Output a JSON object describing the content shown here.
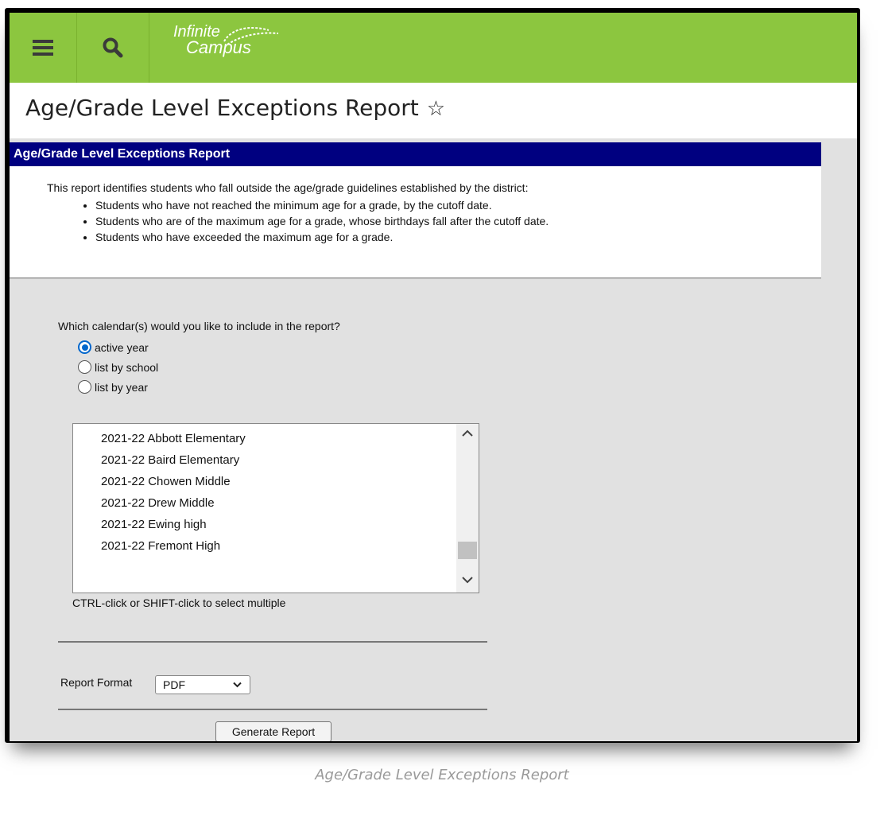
{
  "app": {
    "logo_line1": "Infinite",
    "logo_line2": "Campus",
    "brand_color": "#8cc63f",
    "icons": [
      "menu-icon",
      "search-icon",
      "star-icon"
    ]
  },
  "page": {
    "title": "Age/Grade Level Exceptions Report",
    "star": "☆"
  },
  "report": {
    "header": "Age/Grade Level Exceptions Report",
    "header_color": "#000080",
    "intro": "This report identifies students who fall outside the age/grade guidelines established by the district:",
    "bullets": [
      "Students who have not reached the minimum age for a grade, by the cutoff date.",
      "Students who are of the maximum age for a grade, whose birthdays fall after the cutoff date.",
      "Students who have exceeded the maximum age for a grade."
    ]
  },
  "form": {
    "question": "Which calendar(s) would you like to include in the report?",
    "radios": [
      {
        "label": "active year",
        "checked": true
      },
      {
        "label": "list by school",
        "checked": false
      },
      {
        "label": "list by year",
        "checked": false
      }
    ],
    "calendars": [
      "2021-22 Abbott Elementary",
      "2021-22 Baird Elementary",
      "2021-22 Chowen Middle",
      "2021-22 Drew Middle",
      "2021-22 Ewing high",
      "2021-22 Fremont High"
    ],
    "hint": "CTRL-click or SHIFT-click to select multiple",
    "format_label": "Report Format",
    "format_value": "PDF",
    "generate_label": "Generate Report"
  },
  "caption": "Age/Grade Level Exceptions Report"
}
